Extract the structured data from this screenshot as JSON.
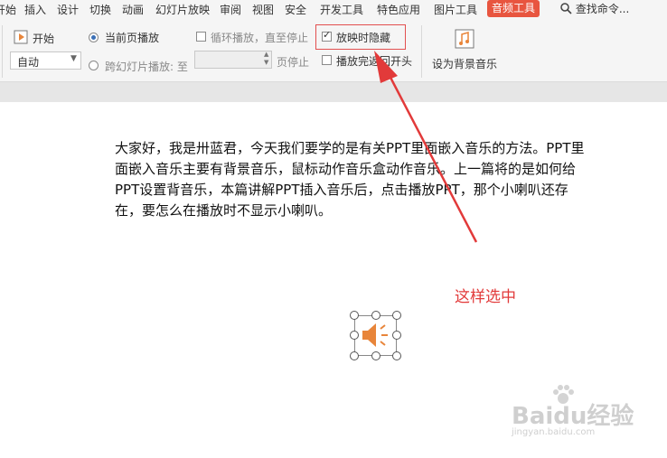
{
  "menu": {
    "tabs": [
      "开始",
      "插入",
      "设计",
      "切换",
      "动画",
      "幻灯片放映",
      "审阅",
      "视图",
      "安全",
      "开发工具",
      "特色应用",
      "图片工具",
      "音频工具"
    ],
    "active_tab": "音频工具",
    "search_label": "查找命令..."
  },
  "ribbon": {
    "start_label": "开始",
    "auto_select_value": "自动",
    "radio_current_page": "当前页播放",
    "radio_cross_slide": "跨幻灯片播放: 至",
    "page_stop_label": "页停止",
    "loop_label": "循环播放，直至停止",
    "hide_during_show_label": "放映时隐藏",
    "rewind_label": "播放完返回开头",
    "set_bg_music_label": "设为背景音乐"
  },
  "slide": {
    "body_text": "大家好，我是卅蓝君，今天我们要学的是有关PPT里面嵌入音乐的方法。PPT里面嵌入音乐主要有背景音乐，鼠标动作音乐盒动作音乐。上一篇将的是如何给PPT设置背音乐，本篇讲解PPT插入音乐后，点击播放PPT，那个小喇叭还存在，要怎么在播放时不显示小喇叭。"
  },
  "annotation": {
    "text": "这样选中",
    "color": "#e23a3a"
  },
  "watermark": {
    "brand": "Baidu经验",
    "url": "jingyan.baidu.com"
  },
  "colors": {
    "accent": "#e8553f",
    "speaker": "#e8853a"
  }
}
